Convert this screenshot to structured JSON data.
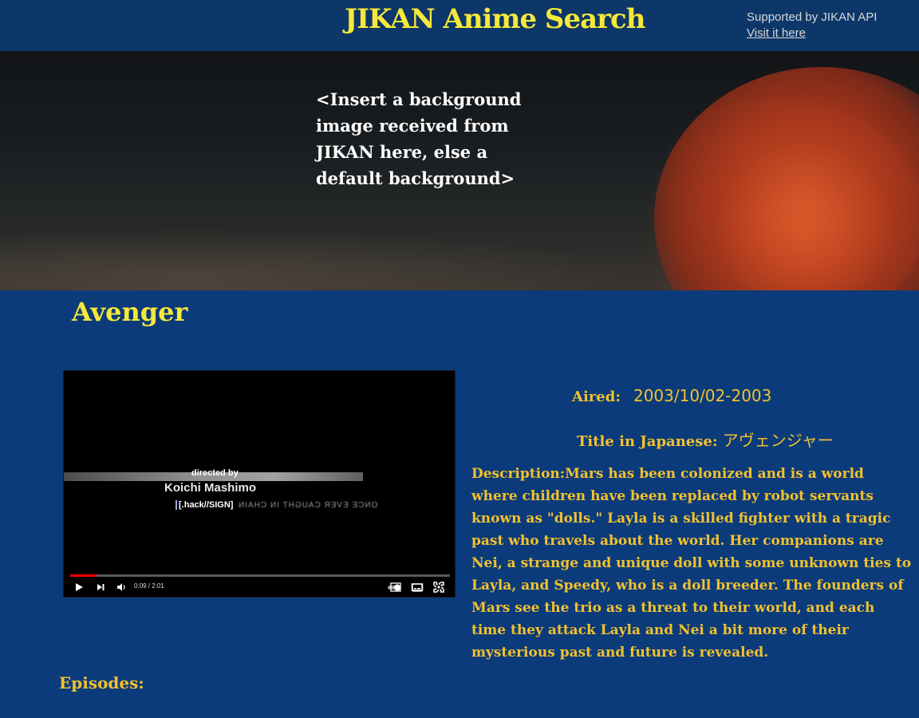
{
  "header": {
    "title": "JIKAN Anime Search",
    "credit_text": "Supported by JIKAN API",
    "credit_link": "Visit it here"
  },
  "hero": {
    "note": "<Insert a background image received from JIKAN here, else a default background>"
  },
  "anime": {
    "title": "Avenger",
    "aired_label": "Aired:",
    "aired_value": "2003/10/02-2003",
    "japanese_label": "Title in Japanese: ",
    "japanese_value": "アヴェンジャー",
    "description": "Description:Mars has been colonized and is a world where children have been replaced by robot servants known as \"dolls.\" Layla is a skilled fighter with a tragic past who travels about the world. Her companions are Nei, a strange and unique doll with some unknown ties to Layla, and Speedy, who is a doll breeder. The founders of Mars see the trio as a threat to their world, and each time they attack Layla and Nei a bit more of their mysterious past and future is revealed."
  },
  "video": {
    "credit_directed": "directed by",
    "credit_name": "Koichi Mashimo",
    "credit_sign": "[.hack//SIGN]",
    "credit_blurred": "ONCE EVER CAUGHT IN CHAIN",
    "time": "0:09 / 2:01",
    "progress_fraction": 0.07,
    "icons": [
      "play-icon",
      "next-icon",
      "volume-icon",
      "autoplay-toggle-icon",
      "subtitles-icon",
      "settings-icon",
      "miniplayer-icon",
      "theater-icon",
      "fullscreen-icon"
    ]
  },
  "episodes": {
    "heading": "Episodes:"
  },
  "colors": {
    "page_bg": "#0b3b7a",
    "header_bg": "#0d3768",
    "title_yellow": "#f6e83a",
    "text_gold": "#f2c12e",
    "progress_red": "#ff0000"
  }
}
